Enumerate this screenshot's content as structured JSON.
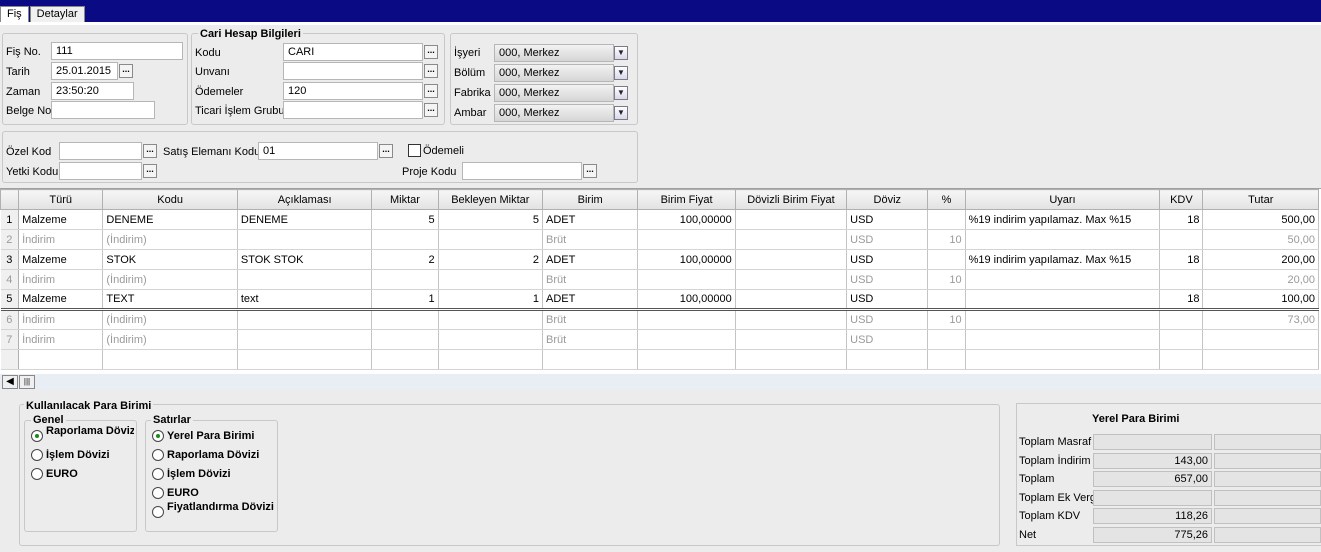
{
  "tabs": [
    "Fiş",
    "Detaylar"
  ],
  "header": {
    "fis_no_label": "Fiş No.",
    "fis_no": "111",
    "tarih_label": "Tarih",
    "tarih": "25.01.2015",
    "zaman_label": "Zaman",
    "zaman": "23:50:20",
    "belge_label": "Belge No.",
    "belge": ""
  },
  "cari": {
    "title": "Cari Hesap Bilgileri",
    "kodu_label": "Kodu",
    "kodu": "CARI",
    "unvani_label": "Unvanı",
    "unvani": "",
    "odemeler_label": "Ödemeler",
    "odemeler": "120",
    "ticari_label": "Ticari İşlem Grubu",
    "ticari": ""
  },
  "org": {
    "isyeri_label": "İşyeri",
    "isyeri": "000, Merkez",
    "bolum_label": "Bölüm",
    "bolum": "000, Merkez",
    "fabrika_label": "Fabrika",
    "fabrika": "000, Merkez",
    "ambar_label": "Ambar",
    "ambar": "000, Merkez"
  },
  "extra": {
    "ozel_label": "Özel Kod",
    "ozel": "",
    "yetki_label": "Yetki Kodu",
    "yetki": "",
    "satis_label": "Satış Elemanı Kodu",
    "satis": "01",
    "odemeli_label": "Ödemeli",
    "proje_label": "Proje Kodu",
    "proje": ""
  },
  "grid": {
    "columns": [
      "Türü",
      "Kodu",
      "Açıklaması",
      "Miktar",
      "Bekleyen Miktar",
      "Birim",
      "Birim Fiyat",
      "Dövizli Birim Fiyat",
      "Döviz",
      "%",
      "Uyarı",
      "KDV",
      "Tutar"
    ],
    "rows": [
      {
        "n": "1",
        "c": [
          "Malzeme",
          "DENEME",
          "DENEME",
          "5",
          "5",
          "ADET",
          "100,00000",
          "",
          "USD",
          "",
          "%19 indirim yapılamaz. Max %15",
          "18",
          "500,00"
        ]
      },
      {
        "n": "2",
        "c": [
          "İndirim",
          "(İndirim)",
          "",
          "",
          "",
          "Brüt",
          "",
          "",
          "USD",
          "10",
          "",
          "",
          "50,00"
        ]
      },
      {
        "n": "3",
        "c": [
          "Malzeme",
          "STOK",
          "STOK STOK",
          "2",
          "2",
          "ADET",
          "100,00000",
          "",
          "USD",
          "",
          "%19 indirim yapılamaz. Max %15",
          "18",
          "200,00"
        ]
      },
      {
        "n": "4",
        "c": [
          "İndirim",
          "(İndirim)",
          "",
          "",
          "",
          "Brüt",
          "",
          "",
          "USD",
          "10",
          "",
          "",
          "20,00"
        ]
      },
      {
        "n": "5",
        "c": [
          "Malzeme",
          "TEXT",
          "text",
          "1",
          "1",
          "ADET",
          "100,00000",
          "",
          "USD",
          "",
          "",
          "18",
          "100,00"
        ]
      },
      {
        "n": "6",
        "c": [
          "İndirim",
          "(İndirim)",
          "",
          "",
          "",
          "Brüt",
          "",
          "",
          "USD",
          "10",
          "",
          "",
          "73,00"
        ]
      },
      {
        "n": "7",
        "c": [
          "İndirim",
          "(İndirim)",
          "",
          "",
          "",
          "Brüt",
          "",
          "",
          "USD",
          "",
          "",
          "",
          ""
        ]
      },
      {
        "n": "",
        "c": [
          "",
          "",
          "",
          "",
          "",
          "",
          "",
          "",
          "",
          "",
          "",
          "",
          ""
        ]
      }
    ]
  },
  "para": {
    "title": "Kullanılacak Para Birimi",
    "genel_title": "Genel",
    "genel": [
      "Raporlama Dövizi",
      "İşlem Dövizi",
      "EURO"
    ],
    "satirlar_title": "Satırlar",
    "satirlar": [
      "Yerel Para Birimi",
      "Raporlama Dövizi",
      "İşlem Dövizi",
      "EURO",
      "Fiyatlandırma Dövizi"
    ]
  },
  "totals": {
    "title": "Yerel Para Birimi",
    "rows": [
      {
        "label": "Toplam Masraf",
        "value": ""
      },
      {
        "label": "Toplam İndirim",
        "value": "143,00"
      },
      {
        "label": "Toplam",
        "value": "657,00"
      },
      {
        "label": "Toplam Ek Vergi",
        "value": ""
      },
      {
        "label": "Toplam KDV",
        "value": "118,26"
      },
      {
        "label": "Net",
        "value": "775,26"
      }
    ]
  },
  "icons": {
    "dots": "ellipsis-icon",
    "combo": "chevron-down-icon",
    "scroll_left": "arrow-left-icon"
  }
}
